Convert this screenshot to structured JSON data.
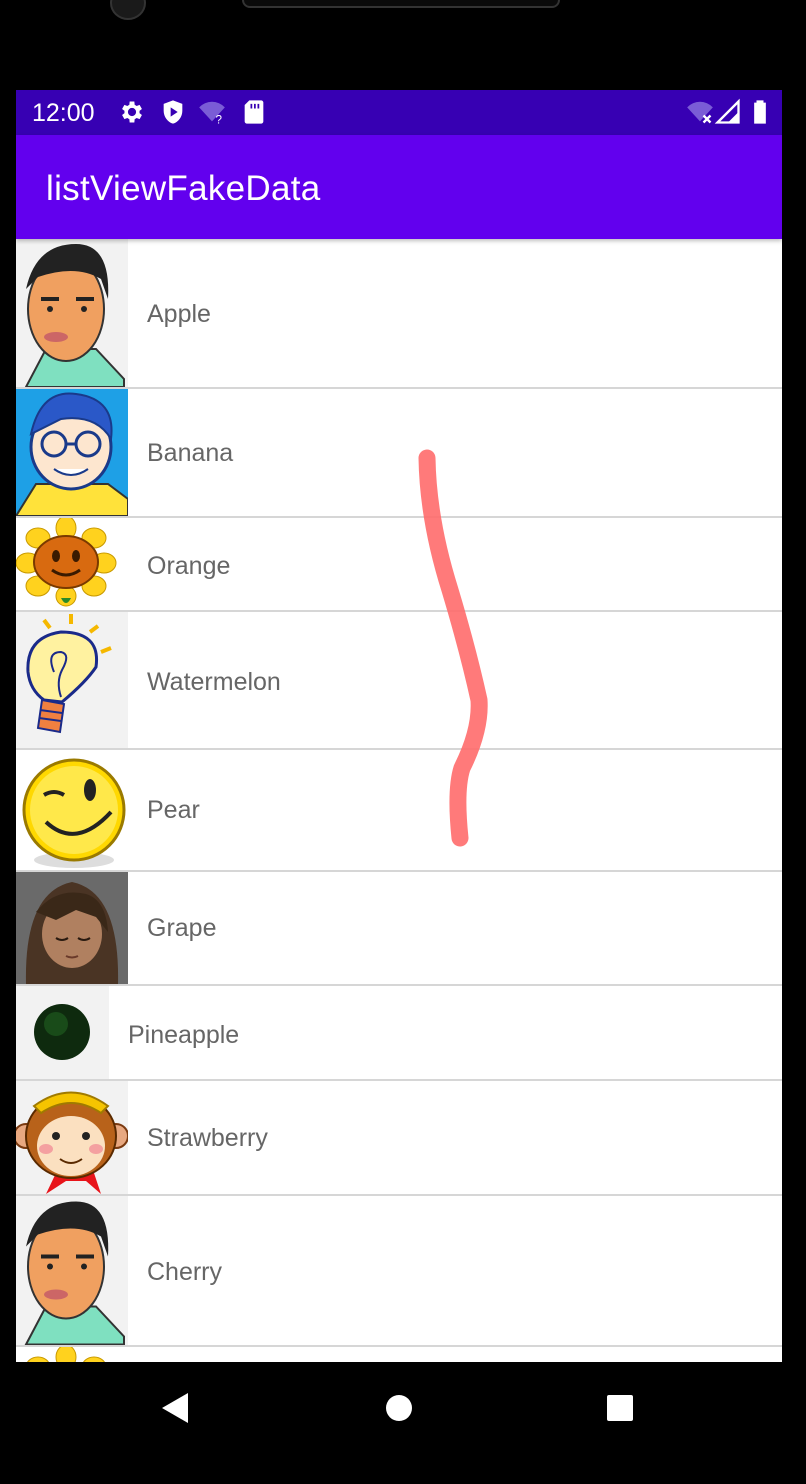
{
  "status_bar": {
    "time": "12:00"
  },
  "app_bar": {
    "title": "listViewFakeData"
  },
  "list": {
    "items": [
      {
        "label": "Apple",
        "icon": "man-avatar-icon"
      },
      {
        "label": "Banana",
        "icon": "glasses-boy-icon"
      },
      {
        "label": "Orange",
        "icon": "sunflower-icon"
      },
      {
        "label": "Watermelon",
        "icon": "lightbulb-icon"
      },
      {
        "label": "Pear",
        "icon": "wink-smiley-icon"
      },
      {
        "label": "Grape",
        "icon": "anime-girl-icon"
      },
      {
        "label": "Pineapple",
        "icon": "dark-circle-icon"
      },
      {
        "label": "Strawberry",
        "icon": "monkey-icon"
      },
      {
        "label": "Cherry",
        "icon": "man-avatar-icon"
      }
    ]
  },
  "colors": {
    "status_bar": "#3700b3",
    "app_bar": "#6200ee",
    "label_text": "#666666",
    "annotation_stroke": "#ff6b6b"
  }
}
